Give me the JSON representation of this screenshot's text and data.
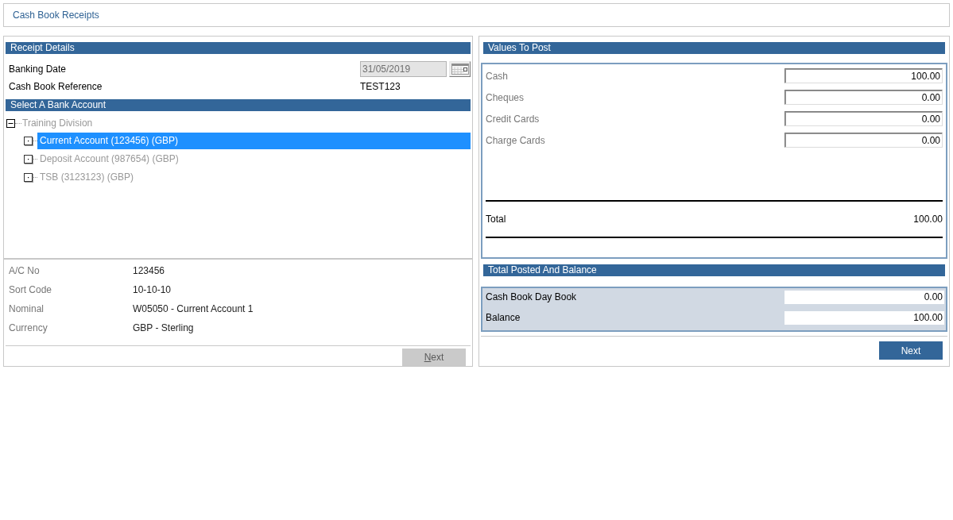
{
  "page": {
    "title": "Cash Book Receipts"
  },
  "receipt_details": {
    "title": "Receipt Details",
    "fields": [
      {
        "kind": "date",
        "label": "Banking Date",
        "value": "31/05/2019",
        "disabled": true
      },
      {
        "kind": "text",
        "label": "Cash Book Reference",
        "value": "TEST123"
      }
    ]
  },
  "bank_account": {
    "title": "Select A Bank Account",
    "tree": [
      {
        "label": "Training Division",
        "expanded": true,
        "selected": false,
        "children": [
          {
            "label": "Current Account (123456) (GBP)",
            "selected": true
          },
          {
            "label": "Deposit Account (987654) (GBP)",
            "selected": false
          },
          {
            "label": "TSB (3123123) (GBP)",
            "selected": false
          }
        ]
      }
    ]
  },
  "account_details": [
    {
      "label": "A/C No",
      "value": "123456"
    },
    {
      "label": "Sort Code",
      "value": "10-10-10"
    },
    {
      "label": "Nominal",
      "value": "W05050 - Current Account 1"
    },
    {
      "label": "Currency",
      "value": "GBP - Sterling"
    }
  ],
  "left_next_button": {
    "label": "Next",
    "disabled": true
  },
  "values_to_post": {
    "title": "Values To Post",
    "rows": [
      {
        "label": "Cash",
        "value": "100.00"
      },
      {
        "label": "Cheques",
        "value": "0.00"
      },
      {
        "label": "Credit Cards",
        "value": "0.00"
      },
      {
        "label": "Charge Cards",
        "value": "0.00"
      }
    ],
    "total": {
      "label": "Total",
      "value": "100.00"
    }
  },
  "total_posted": {
    "title": "Total Posted And Balance",
    "rows": [
      {
        "label": "Cash Book Day Book",
        "value": "0.00"
      },
      {
        "label": "Balance",
        "value": "100.00"
      }
    ]
  },
  "right_next_button": {
    "label": "Next",
    "disabled": false
  }
}
